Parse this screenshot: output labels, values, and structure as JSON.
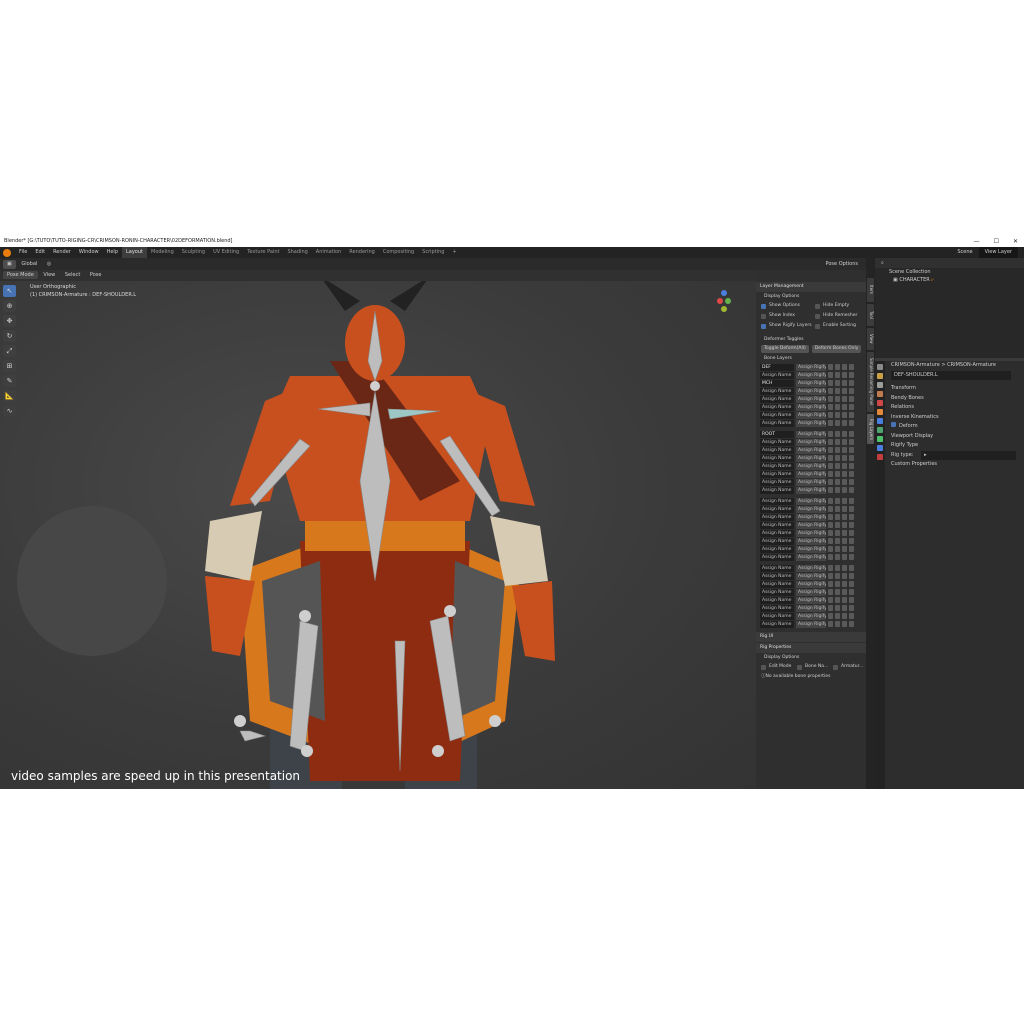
{
  "window": {
    "title": "Blender* [G:\\TUTO\\TUTO-RIGING-CR\\CRIMSON-RONIN-CHARACTER\\02DEFORMATION.blend]"
  },
  "menu": {
    "items": [
      "File",
      "Edit",
      "Render",
      "Window",
      "Help"
    ],
    "workspaces": [
      "Layout",
      "Modeling",
      "Sculpting",
      "UV Editing",
      "Texture Paint",
      "Shading",
      "Animation",
      "Rendering",
      "Compositing",
      "Scripting"
    ],
    "active_workspace": "Layout",
    "add_workspace": "+",
    "scene": "Scene",
    "view_layer": "View Layer"
  },
  "viewport": {
    "mode": "Pose Mode",
    "header_menu": [
      "View",
      "Select",
      "Pose"
    ],
    "transform_orientation": "Global",
    "pose_options": "Pose Options",
    "overlay_view": "User Orthographic",
    "overlay_object": "(1) CRIMSON-Armature : DEF-SHOULDER.L",
    "caption": "video samples are speed up in this presentation"
  },
  "sidepanel": {
    "layer_management": "Layer Management",
    "display_options": "Display Options",
    "options": [
      {
        "label": "Show Options",
        "checked": true
      },
      {
        "label": "Hide Empty",
        "checked": false
      },
      {
        "label": "Show Index",
        "checked": false
      },
      {
        "label": "Hide Remesher",
        "checked": false
      },
      {
        "label": "Show Rigify Layers",
        "checked": true
      },
      {
        "label": "Enable Sorting",
        "checked": false
      }
    ],
    "deformer_toggles": "Deformer Toggles",
    "toggle_btn_1": "Toggle Deform(All)",
    "toggle_btn_2": "Deform Bones Only",
    "bone_layers": "Bone Layers",
    "assign_label": "Assign Name",
    "rigify_label": "Assign Rigify L",
    "groups": [
      [
        "DEF",
        "",
        "",
        "",
        "",
        "",
        "",
        ""
      ],
      [
        "ROOT",
        "",
        "",
        "",
        "",
        "",
        "",
        ""
      ],
      [
        "",
        "",
        "",
        "",
        "",
        "",
        "",
        ""
      ],
      [
        "",
        "",
        "",
        "",
        "",
        "",
        "",
        ""
      ]
    ],
    "second_named": "MCH",
    "rig_ui": "Rig UI",
    "rig_properties": "Rig Properties",
    "display_options_2": "Display Options",
    "edit_mode": "Edit Mode",
    "bone_na": "Bone Na...",
    "armatur": "Armatur...",
    "no_props": "No available bone properties"
  },
  "vtabs": [
    "Item",
    "Tool",
    "View",
    "Simple Renaming Panel",
    "Rig Layers"
  ],
  "outliner": {
    "scene_collection": "Scene Collection",
    "character": "CHARACTER"
  },
  "properties": {
    "armature_a": "CRIMSON-Armature",
    "armature_b": "CRIMSON-Armature",
    "bone_name": "DEF-SHOULDER.L",
    "sections": [
      "Transform",
      "Bendy Bones",
      "Relations",
      "Inverse Kinematics"
    ],
    "deform": "Deform",
    "viewport_display": "Viewport Display",
    "rigify_type": "Rigify Type",
    "rig_type_label": "Rig type:",
    "custom_properties": "Custom Properties"
  },
  "colors": {
    "accent_blue": "#4772b3",
    "blender_orange": "#e87d0d",
    "bone_gray": "#bdbdbd",
    "skin_red": "#c8501f"
  }
}
